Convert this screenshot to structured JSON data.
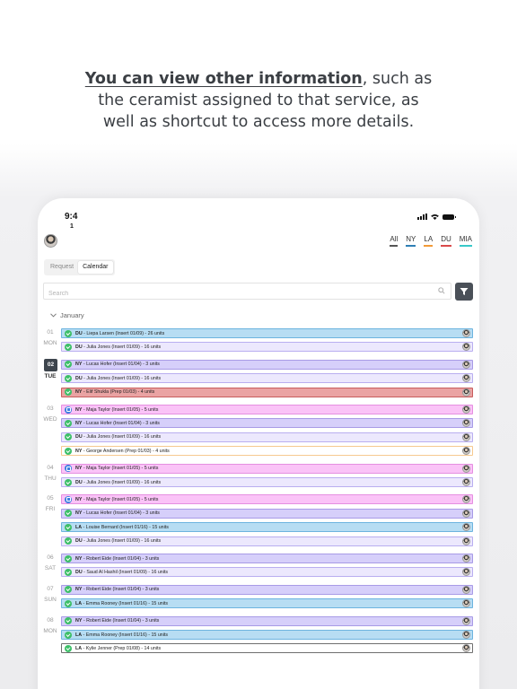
{
  "headline": {
    "highlight": "You can view other information",
    "line1_rest": ", such as",
    "line2": "the ceramist assigned to that service, as",
    "line3": "well as shortcut to access more details."
  },
  "status_bar": {
    "time_line1": "9:4",
    "time_line2": "1"
  },
  "locations": [
    {
      "label": "All",
      "color": "#555555"
    },
    {
      "label": "NY",
      "color": "#2f7fb5"
    },
    {
      "label": "LA",
      "color": "#f29a38"
    },
    {
      "label": "DU",
      "color": "#d94a4a"
    },
    {
      "label": "MIA",
      "color": "#38c9c9"
    }
  ],
  "tabs": {
    "request": "Request",
    "calendar": "Calendar"
  },
  "search": {
    "placeholder": "Search"
  },
  "month": "January",
  "days": [
    {
      "num": "01",
      "weekday": "MON",
      "today": false,
      "rows": [
        {
          "style": "blue",
          "status": "ok",
          "loc": "DU",
          "text": " - Liepa Larsen (Insert 01/09) - 26 units"
        },
        {
          "style": "lav",
          "status": "ok",
          "loc": "DU",
          "text": " - Julia Jones (Insert 01/09) - 16 units"
        }
      ]
    },
    {
      "num": "02",
      "weekday": "TUE",
      "today": true,
      "rows": [
        {
          "style": "purple",
          "status": "ok",
          "loc": "NY",
          "text": " - Lucas Hofer (Insert 01/04) - 3 units"
        },
        {
          "style": "lav",
          "status": "ok",
          "loc": "DU",
          "text": " - Julia Jones (Insert 01/09) - 16 units"
        },
        {
          "style": "red",
          "status": "ok",
          "loc": "NY",
          "text": " - Elif Shukla (Prep 01/03) - 4 units"
        }
      ]
    },
    {
      "num": "03",
      "weekday": "WED",
      "today": false,
      "rows": [
        {
          "style": "pink",
          "status": "info",
          "loc": "NY",
          "text": " - Maja Taylor (Insert 01/05) - 5 units"
        },
        {
          "style": "purple",
          "status": "ok",
          "loc": "NY",
          "text": " - Lucas Hofer (Insert 01/04) - 3 units"
        },
        {
          "style": "lav",
          "status": "ok",
          "loc": "DU",
          "text": " - Julia Jones (Insert 01/09) - 16 units"
        },
        {
          "style": "peach",
          "status": "ok",
          "loc": "NY",
          "text": " - George Andersen (Prep  01/03) - 4 units"
        }
      ]
    },
    {
      "num": "04",
      "weekday": "THU",
      "today": false,
      "rows": [
        {
          "style": "pink",
          "status": "info",
          "loc": "NY",
          "text": " - Maja Taylor (Insert 01/05) - 5 units"
        },
        {
          "style": "lav",
          "status": "ok",
          "loc": "DU",
          "text": " - Julia Jones (Insert 01/09) - 16 units"
        }
      ]
    },
    {
      "num": "05",
      "weekday": "FRI",
      "today": false,
      "rows": [
        {
          "style": "pink",
          "status": "info",
          "loc": "NY",
          "text": " - Maja Taylor (Insert 01/05) - 5 units"
        },
        {
          "style": "purple",
          "status": "ok",
          "loc": "NY",
          "text": " - Lucas Hofer (Insert 01/04) - 3 units"
        },
        {
          "style": "blue",
          "status": "ok",
          "loc": "LA",
          "text": " - Louise Bernard (Insert 01/16) - 15 units"
        },
        {
          "style": "lav",
          "status": "ok",
          "loc": "DU",
          "text": " - Julia Jones (Insert 01/09) - 16 units"
        }
      ]
    },
    {
      "num": "06",
      "weekday": "SAT",
      "today": false,
      "rows": [
        {
          "style": "purple",
          "status": "ok",
          "loc": "NY",
          "text": " - Robert Eide (Insert 01/04) - 3 units"
        },
        {
          "style": "lav",
          "status": "ok",
          "loc": "DU",
          "text": " - Saud Al Hashil (Insert 01/09) - 16 units"
        }
      ]
    },
    {
      "num": "07",
      "weekday": "SUN",
      "today": false,
      "rows": [
        {
          "style": "purple",
          "status": "ok",
          "loc": "NY",
          "text": " - Robert Eide (Insert 01/04) - 3 units"
        },
        {
          "style": "blue",
          "status": "ok",
          "loc": "LA",
          "text": " - Emma Rooney (Insert 01/16) - 15 units"
        }
      ]
    },
    {
      "num": "08",
      "weekday": "MON",
      "today": false,
      "rows": [
        {
          "style": "purple",
          "status": "ok",
          "loc": "NY",
          "text": " - Robert Eide (Insert 01/04) - 3 units"
        },
        {
          "style": "blue",
          "status": "ok",
          "loc": "LA",
          "text": " - Emma Rooney (Insert 01/16) - 15 units"
        },
        {
          "style": "white",
          "status": "ok",
          "loc": "LA",
          "text": " - Kylie Jenner (Prep 01/08) - 14 units"
        }
      ]
    }
  ]
}
